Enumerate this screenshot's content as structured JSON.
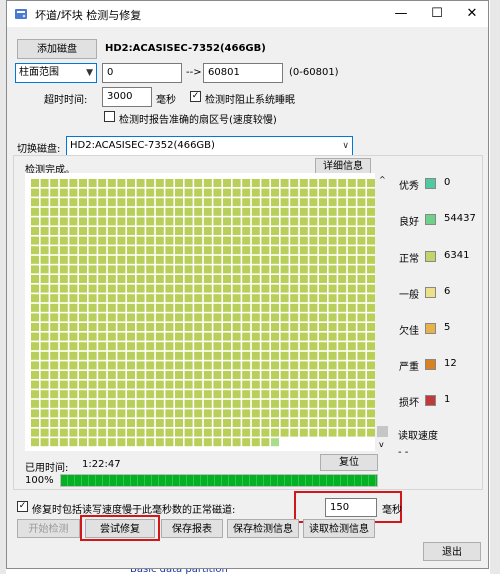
{
  "window": {
    "title": "坏道/坏块 检测与修复"
  },
  "titlebar_buttons": [
    "—",
    "☐",
    "✕"
  ],
  "toolbar": {
    "add_disk_label": "添加磁盘",
    "disk_name": "HD2:ACASISEC-7352(466GB)",
    "range_mode": "柱面范围",
    "range_start": "0",
    "range_arrow": "-->",
    "range_end": "60801",
    "range_hint": "(0-60801)",
    "timeout_label": "超时时间:",
    "timeout_value": "3000",
    "timeout_unit": "毫秒",
    "prevent_sleep_label": "检测时阻止系统睡眠",
    "prevent_sleep_checked": true,
    "report_sector_label": "检测时报告准确的扇区号(速度较慢)",
    "report_sector_checked": false
  },
  "switch": {
    "label": "切换磁盘:",
    "disk": "HD2:ACASISEC-7352(466GB)"
  },
  "scan": {
    "status": "检测完成。",
    "detail_button": "详细信息",
    "block_colors": {
      "good": "#b8cf5a",
      "fine": "#a9dc8c",
      "border": "#ffffff"
    }
  },
  "legend": [
    {
      "label": "优秀",
      "value": "0",
      "color": "#4fc9a0"
    },
    {
      "label": "良好",
      "value": "54437",
      "color": "#6fd08a"
    },
    {
      "label": "正常",
      "value": "6341",
      "color": "#c3d56a"
    },
    {
      "label": "一般",
      "value": "6",
      "color": "#ede08a"
    },
    {
      "label": "欠佳",
      "value": "5",
      "color": "#e8b24a"
    },
    {
      "label": "严重",
      "value": "12",
      "color": "#d98220"
    },
    {
      "label": "损坏",
      "value": "1",
      "color": "#c03a3a"
    }
  ],
  "read_speed": {
    "label": "读取速度",
    "value": "- -"
  },
  "elapsed": {
    "label": "已用时间:",
    "value": "1:22:47",
    "reset_button": "复位"
  },
  "progress": {
    "percent_label": "100%",
    "fraction": 1.0
  },
  "repair": {
    "checkbox_label": "修复时包括读写速度慢于此毫秒数的正常磁道:",
    "checked": true,
    "threshold": "150",
    "unit": "毫秒"
  },
  "actions": {
    "start": "开始检测",
    "try_repair": "尝试修复",
    "save_report": "保存报表",
    "save_info": "保存检测信息",
    "load_info": "读取检测信息",
    "exit": "退出"
  },
  "background": {
    "bottom_text": "Basic data partition"
  }
}
